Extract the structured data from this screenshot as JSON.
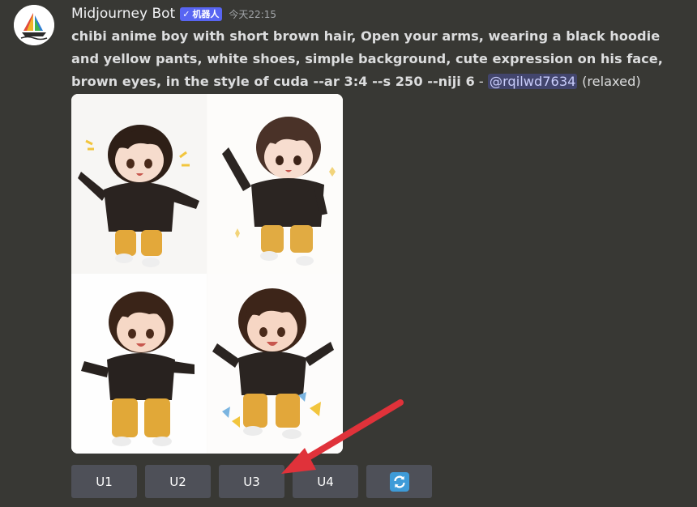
{
  "message": {
    "author": "Midjourney Bot",
    "badge": "机器人",
    "badge_check": "✓",
    "timestamp": "今天22:15",
    "prompt_lines": [
      "chibi anime boy with short brown hair, Open your arms, wearing a black hoodie",
      "and yellow pants, white shoes, simple background, cute expression on his face,",
      "brown eyes, in the style of cuda --ar 3:4 --s 250 --niji 6"
    ],
    "separator": " - ",
    "mention": "@rqilwd7634",
    "mode": "(relaxed)"
  },
  "avatar_icon": "sailboat-logo-icon",
  "grid_images": [
    {
      "label": "chibi-boy-image-1"
    },
    {
      "label": "chibi-boy-image-2"
    },
    {
      "label": "chibi-boy-image-3"
    },
    {
      "label": "chibi-boy-image-4"
    }
  ],
  "buttons": {
    "u1": "U1",
    "u2": "U2",
    "u3": "U3",
    "u4": "U4",
    "refresh_icon": "refresh-icon"
  },
  "colors": {
    "background": "#383834",
    "button": "#4e5058",
    "badge": "#5865f2",
    "annotation_arrow": "#e0323a",
    "refresh": "#3e9bd8"
  }
}
